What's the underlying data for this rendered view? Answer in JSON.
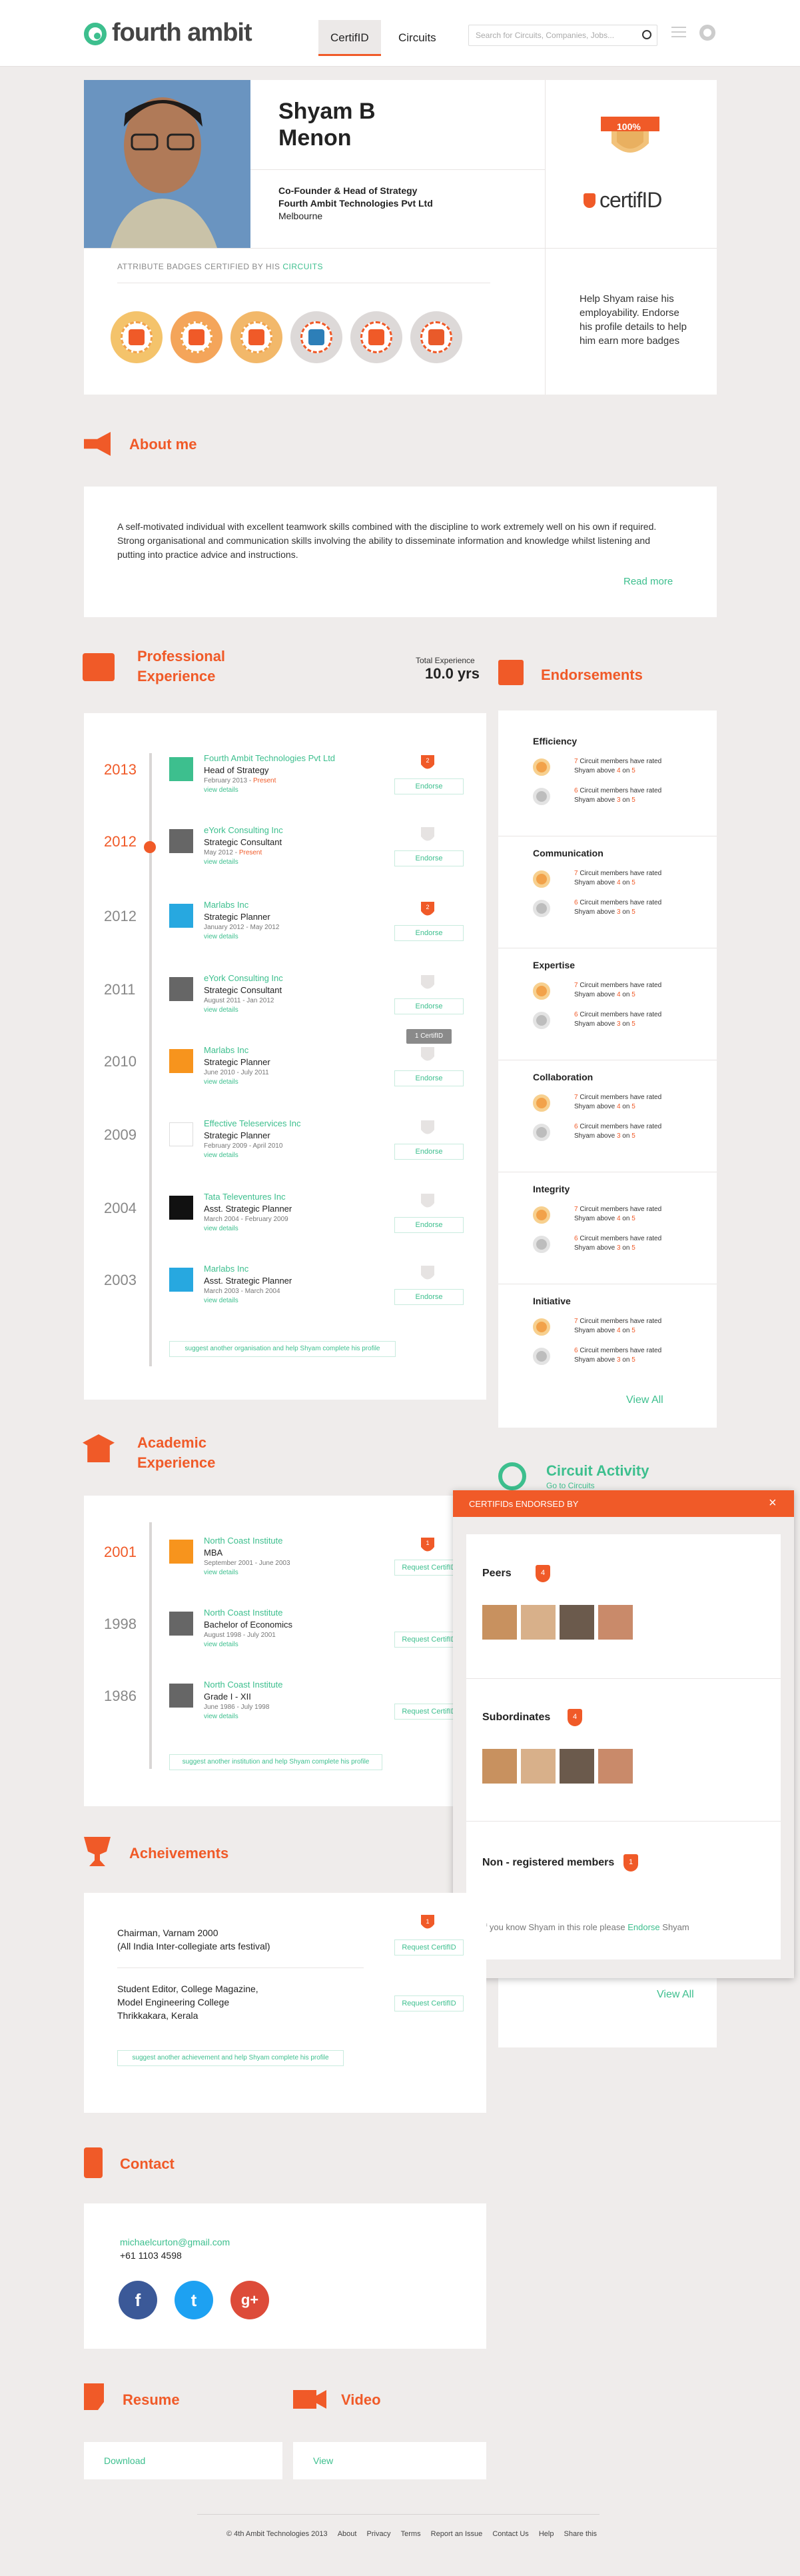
{
  "header": {
    "logo": "fourth ambit",
    "tabs": [
      "CertifID",
      "Circuits"
    ],
    "search_placeholder": "Search for Circuits, Companies, Jobs..."
  },
  "profile": {
    "first_name": "Shyam B",
    "last_name": "Menon",
    "title": "Co-Founder & Head of Strategy",
    "company": "Fourth Ambit Technologies Pvt Ltd",
    "location": "Melbourne",
    "badges_label_prefix": "ATTRIBUTE BADGES CERTIFIED BY HIS ",
    "badges_label_link": "CIRCUITS",
    "certifid_percent": "100%",
    "certifid_logo": "certifID",
    "help_text": "Help Shyam raise his employability. Endorse his profile details to help him earn more badges"
  },
  "about": {
    "title": "About me",
    "text": "A self-motivated individual with excellent teamwork skills combined with the discipline to work extremely well on his own if required. Strong organisational and communication skills involving the ability to disseminate information and knowledge whilst listening and putting into practice advice and instructions.",
    "read_more": "Read more"
  },
  "experience": {
    "title_line1": "Professional",
    "title_line2": "Experience",
    "total_label": "Total Experience",
    "total_value": "10.0 yrs",
    "items": [
      {
        "year": "2013",
        "company": "Fourth Ambit Technologies Pvt Ltd",
        "role": "Head of Strategy",
        "date": "February 2013 - ",
        "present": "Present",
        "view": "view details",
        "btn": "Endorse",
        "count": "2",
        "logo_color": "#3dbf8e"
      },
      {
        "year": "2012",
        "company": "eYork Consulting Inc",
        "role": "Strategic Consultant",
        "date": "May 2012 - ",
        "present": "Present",
        "view": "view details",
        "btn": "Endorse",
        "count": "",
        "logo_color": "#666666"
      },
      {
        "year": "2012",
        "company": "Marlabs Inc",
        "role": "Strategic Planner",
        "date": "January 2012 - May 2012",
        "present": "",
        "view": "view details",
        "btn": "Endorse",
        "count": "2",
        "logo_color": "#27a8e0"
      },
      {
        "year": "2011",
        "company": "eYork Consulting Inc",
        "role": "Strategic Consultant",
        "date": "August 2011 - Jan 2012",
        "present": "",
        "view": "view details",
        "btn": "Endorse",
        "count": "",
        "logo_color": "#666666"
      },
      {
        "year": "2010",
        "company": "Marlabs Inc",
        "role": "Strategic Planner",
        "date": "June 2010 - July 2011",
        "present": "",
        "view": "view details",
        "btn": "Endorse",
        "count": "",
        "logo_color": "#f7941d"
      },
      {
        "year": "2009",
        "company": "Effective Teleservices Inc",
        "role": "Strategic Planner",
        "date": "February 2009 - April 2010",
        "present": "",
        "view": "view details",
        "btn": "Endorse",
        "count": "",
        "logo_color": "#ffffff"
      },
      {
        "year": "2004",
        "company": "Tata Televentures Inc",
        "role": "Asst. Strategic Planner",
        "date": "March 2004 - February 2009",
        "present": "",
        "view": "view details",
        "btn": "Endorse",
        "count": "",
        "logo_color": "#111111"
      },
      {
        "year": "2003",
        "company": "Marlabs Inc",
        "role": "Asst. Strategic Planner",
        "date": "March 2003 - March 2004",
        "present": "",
        "view": "view details",
        "btn": "Endorse",
        "count": "",
        "logo_color": "#27a8e0"
      }
    ],
    "tooltip": "1 CertifID",
    "suggest": "suggest another organisation and help Shyam complete his profile"
  },
  "endorsements": {
    "title": "Endorsements",
    "categories": [
      {
        "name": "Efficiency",
        "r1a": "7",
        "r1b": "4",
        "r2a": "6",
        "r2b": "3"
      },
      {
        "name": "Communication",
        "r1a": "7",
        "r1b": "4",
        "r2a": "6",
        "r2b": "3"
      },
      {
        "name": "Expertise",
        "r1a": "7",
        "r1b": "4",
        "r2a": "6",
        "r2b": "3"
      },
      {
        "name": "Collaboration",
        "r1a": "7",
        "r1b": "4",
        "r2a": "6",
        "r2b": "3"
      },
      {
        "name": "Integrity",
        "r1a": "7",
        "r1b": "4",
        "r2a": "6",
        "r2b": "3"
      },
      {
        "name": "Initiative",
        "r1a": "7",
        "r1b": "4",
        "r2a": "6",
        "r2b": "3"
      }
    ],
    "row_mid": " Circuit members have rated",
    "row_line2": "Shyam above ",
    "on": " on ",
    "five": "5",
    "view_all": "View All"
  },
  "academic": {
    "title_line1": "Academic",
    "title_line2": "Experience",
    "items": [
      {
        "year": "2001",
        "inst": "North Coast Institute",
        "degree": "MBA",
        "date": "September 2001 - June 2003",
        "view": "view details",
        "btn": "Request CertifID",
        "count": "1",
        "logo_color": "#f7941d"
      },
      {
        "year": "1998",
        "inst": "North Coast Institute",
        "degree": "Bachelor of Economics",
        "date": "August 1998 - July 2001",
        "view": "view details",
        "btn": "Request CertifID",
        "count": "",
        "logo_color": "#666666"
      },
      {
        "year": "1986",
        "inst": "North Coast Institute",
        "degree": "Grade I - XII",
        "date": "June 1986 - July 1998",
        "view": "view details",
        "btn": "Request CertifID",
        "count": "",
        "logo_color": "#666666"
      }
    ],
    "suggest": "suggest another institution and help Shyam complete his profile"
  },
  "circuit": {
    "title": "Circuit Activity",
    "sub": "Go to Circuits",
    "view_all": "View All"
  },
  "popup": {
    "header": "CERTIFIDs ENDORSED BY",
    "close": "×",
    "peers": "Peers",
    "peers_count": "4",
    "subs": "Subordinates",
    "subs_count": "4",
    "nonreg": "Non - registered members",
    "nonreg_count": "1",
    "footer_pre": "If you know Shyam in this role please ",
    "footer_link": "Endorse",
    "footer_post": " Shyam"
  },
  "achievements": {
    "title": "Acheivements",
    "items": [
      {
        "line1": "Chairman, Varnam 2000",
        "line2": "(All India Inter-collegiate arts festival)",
        "line3": "",
        "line4": "",
        "btn": "Request CertifID",
        "count": "1"
      },
      {
        "line1": "Student Editor, College Magazine,",
        "line2": "Model Engineering College",
        "line3": "Thrikkakara, Kerala",
        "line4": "",
        "btn": "Request CertifID",
        "count": ""
      }
    ],
    "suggest": "suggest another achievement and help Shyam complete his profile"
  },
  "contact": {
    "title": "Contact",
    "email": "michaelcurton@gmail.com",
    "phone": "+61 1103 4598",
    "social": [
      "f",
      "t",
      "g+"
    ]
  },
  "resume": {
    "title": "Resume",
    "link": "Download"
  },
  "video": {
    "title": "Video",
    "link": "View"
  },
  "footer": {
    "copy": "© 4th Ambit Technologies 2013",
    "links": [
      "About",
      "Privacy",
      "Terms",
      "Report an Issue",
      "Contact Us",
      "Help",
      "Share this"
    ]
  },
  "colors": {
    "accent": "#f05a28",
    "green": "#3dbf8e",
    "bg": "#efeceb"
  }
}
